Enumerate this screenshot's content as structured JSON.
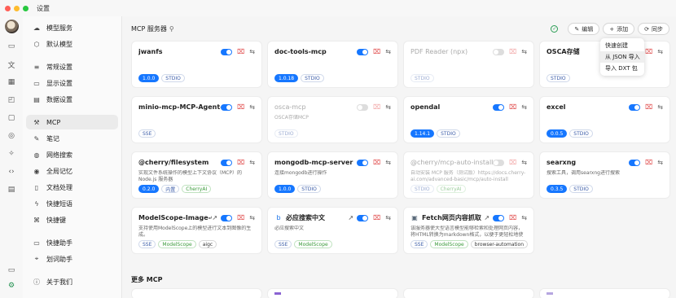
{
  "window": {
    "title": "设置",
    "traffic_colors": [
      "#ff5f57",
      "#febc2e",
      "#28c840"
    ]
  },
  "sidebar": {
    "items": [
      {
        "label": "模型服务",
        "icon": "cloud-icon"
      },
      {
        "label": "默认模型",
        "icon": "cube-icon"
      },
      {
        "label": "常规设置",
        "icon": "sliders-icon"
      },
      {
        "label": "显示设置",
        "icon": "display-icon"
      },
      {
        "label": "数据设置",
        "icon": "database-icon"
      },
      {
        "label": "MCP",
        "icon": "hammer-icon",
        "active": true
      },
      {
        "label": "笔记",
        "icon": "note-icon"
      },
      {
        "label": "网络搜索",
        "icon": "globe-icon"
      },
      {
        "label": "全局记忆",
        "icon": "memory-icon"
      },
      {
        "label": "文档处理",
        "icon": "document-icon"
      },
      {
        "label": "快捷短语",
        "icon": "zap-icon"
      },
      {
        "label": "快捷键",
        "icon": "command-icon"
      },
      {
        "label": "快捷助手",
        "icon": "assistant-icon"
      },
      {
        "label": "划词助手",
        "icon": "select-icon"
      },
      {
        "label": "关于我们",
        "icon": "info-icon"
      }
    ]
  },
  "main": {
    "header_title": "MCP 服务器",
    "edit_label": "编辑",
    "add_label": "添加",
    "sync_label": "同步",
    "dropdown": [
      "快速创建",
      "从 JSON 导入",
      "导入 DXT 包"
    ],
    "more_title": "更多 MCP",
    "cards": [
      {
        "name": "jwanfs",
        "desc": "",
        "enabled": true,
        "tags": [
          "1.0.0",
          "STDIO"
        ]
      },
      {
        "name": "doc-tools-mcp",
        "desc": "",
        "enabled": true,
        "tags": [
          "1.0.18",
          "STDIO"
        ]
      },
      {
        "name": "PDF Reader (npx)",
        "desc": "",
        "enabled": false,
        "tags": [
          "STDIO"
        ]
      },
      {
        "name": "OSCA存储",
        "desc": "",
        "enabled": true,
        "tags": [
          "STDIO"
        ]
      },
      {
        "name": "minio-mcp-MCP-Agent-Ch...",
        "desc": "",
        "enabled": true,
        "tags": [
          "SSE"
        ]
      },
      {
        "name": "osca-mcp",
        "desc": "OSCA存储MCP",
        "enabled": false,
        "tags": [
          "STDIO"
        ]
      },
      {
        "name": "opendal",
        "desc": "",
        "enabled": true,
        "tags": [
          "1.14.1",
          "STDIO"
        ]
      },
      {
        "name": "excel",
        "desc": "",
        "enabled": true,
        "tags": [
          "0.0.5",
          "STDIO"
        ]
      },
      {
        "name": "@cherry/filesystem",
        "desc": "实现文件系统操作的模型上下文协议（MCP）的 Node.js 服务器",
        "enabled": true,
        "tags": [
          "0.2.0",
          "内置",
          "CherryAI"
        ]
      },
      {
        "name": "mongodb-mcp-server",
        "desc": "连接mongodb进行操作",
        "enabled": true,
        "tags": [
          "1.0.0",
          "STDIO"
        ]
      },
      {
        "name": "@cherry/mcp-auto-install",
        "desc": "自动安装 MCP 服务（测试版）https://docs.cherry-ai.com/advanced-basic/mcp/auto-install",
        "enabled": false,
        "tags": [
          "STDIO",
          "CherryAI"
        ]
      },
      {
        "name": "searxng",
        "desc": "搜索工具，调用searxng进行搜索",
        "enabled": true,
        "tags": [
          "0.3.5",
          "STDIO"
        ]
      },
      {
        "name": "ModelScope-Image-G...",
        "desc": "支持使用ModelScope上的模型进行文本到图像的生成。",
        "enabled": true,
        "tags": [
          "SSE",
          "ModelScope",
          "aigc"
        ]
      },
      {
        "name": "必应搜索中文",
        "desc": "必应搜索中文",
        "enabled": true,
        "tags": [
          "SSE",
          "ModelScope"
        ]
      },
      {
        "name": "Fetch网页内容抓取",
        "desc": "该服务器使大型语言模型能够检索和处理网页内容，将HTML转换为markdown格式，以便于更轻松地使用。",
        "enabled": true,
        "tags": [
          "SSE",
          "ModelScope",
          "browser-automation"
        ]
      }
    ]
  },
  "colors": {
    "accent": "#1677ff",
    "delete": "#e04a4a",
    "green": "#2a9d54"
  }
}
